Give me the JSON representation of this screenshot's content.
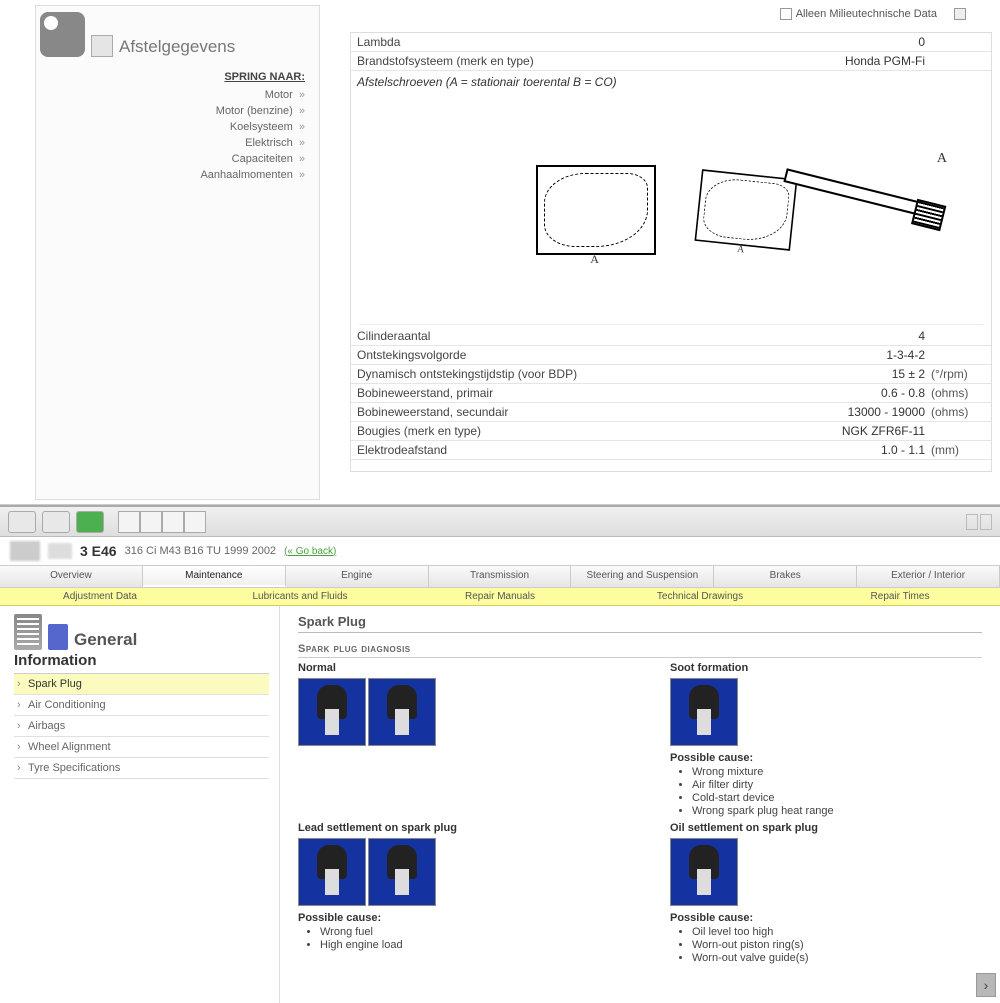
{
  "top": {
    "title": "Afstelgegevens",
    "jump_header": "SPRING NAAR:",
    "nav": [
      "Motor",
      "Motor (benzine)",
      "Koelsysteem",
      "Elektrisch",
      "Capaciteiten",
      "Aanhaalmomenten"
    ],
    "filter_label": "Alleen Milieutechnische Data",
    "rows_above": [
      {
        "label": "Lambda",
        "value": "0",
        "unit": ""
      },
      {
        "label": "Brandstofsysteem (merk en type)",
        "value": "Honda PGM-Fi",
        "unit": ""
      }
    ],
    "diagram_caption": "Afstelschroeven (A = stationair toerental B = CO)",
    "rows_below": [
      {
        "label": "Cilinderaantal",
        "value": "4",
        "unit": ""
      },
      {
        "label": "Ontstekingsvolgorde",
        "value": "1-3-4-2",
        "unit": ""
      },
      {
        "label": "Dynamisch ontstekingstijdstip (voor BDP)",
        "value": "15 ± 2",
        "unit": "(°/rpm)"
      },
      {
        "label": "Bobineweerstand, primair",
        "value": "0.6 - 0.8",
        "unit": "(ohms)"
      },
      {
        "label": "Bobineweerstand, secundair",
        "value": "13000 - 19000",
        "unit": "(ohms)"
      },
      {
        "label": "Bougies (merk en type)",
        "value": "NGK ZFR6F-11",
        "unit": ""
      },
      {
        "label": "Elektrodeafstand",
        "value": "1.0 - 1.1",
        "unit": "(mm)"
      }
    ]
  },
  "bottom": {
    "vehicle": {
      "model": "3 E46",
      "spec": "316 Ci M43 B16 TU 1999 2002",
      "go_back": "(« Go back)"
    },
    "main_tabs": [
      "Overview",
      "Maintenance",
      "Engine",
      "Transmission",
      "Steering and Suspension",
      "Brakes",
      "Exterior / Interior"
    ],
    "main_tab_active": 1,
    "sub_tabs": [
      "Adjustment Data",
      "Lubricants and Fluids",
      "Repair Manuals",
      "Technical Drawings",
      "Repair Times"
    ],
    "sidebar": {
      "general_title": "General",
      "info_title": "Information",
      "items": [
        "Spark Plug",
        "Air Conditioning",
        "Airbags",
        "Wheel Alignment",
        "Tyre Specifications"
      ],
      "active": 0
    },
    "content": {
      "page_title": "Spark Plug",
      "section_title": "Spark plug diagnosis",
      "cells": [
        {
          "title": "Normal",
          "imgs": 2,
          "causes": []
        },
        {
          "title": "Soot formation",
          "imgs": 1,
          "cause_head": "Possible cause:",
          "causes": [
            "Wrong mixture",
            "Air filter dirty",
            "Cold-start device",
            "Wrong spark plug heat range"
          ]
        },
        {
          "title": "Lead settlement on spark plug",
          "imgs": 2,
          "cause_head": "Possible cause:",
          "causes": [
            "Wrong fuel",
            "High engine load"
          ]
        },
        {
          "title": "Oil settlement on spark plug",
          "imgs": 1,
          "cause_head": "Possible cause:",
          "causes": [
            "Oil level too high",
            "Worn-out piston ring(s)",
            "Worn-out valve guide(s)"
          ]
        }
      ]
    }
  }
}
